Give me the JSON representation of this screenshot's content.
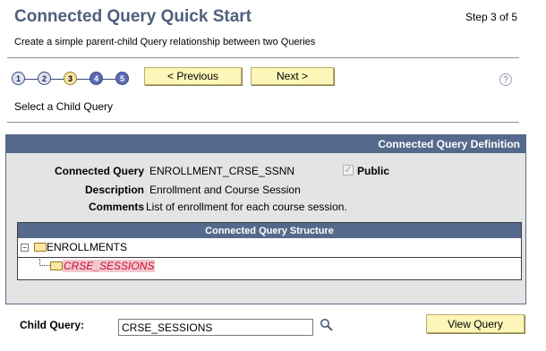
{
  "header": {
    "title": "Connected Query Quick Start",
    "step": "Step 3 of 5",
    "subtitle": "Create a simple parent-child Query relationship between two Queries"
  },
  "wizard": {
    "steps": [
      "1",
      "2",
      "3",
      "4",
      "5"
    ],
    "current_step": 3,
    "previous_label": "< Previous",
    "next_label": "Next >",
    "help_label": "?"
  },
  "section_label": "Select a Child Query",
  "definition": {
    "header": "Connected Query Definition",
    "connected_query_label": "Connected Query",
    "connected_query_value": "ENROLLMENT_CRSE_SSNN",
    "public_label": "Public",
    "public_checked": true,
    "description_label": "Description",
    "description_value": "Enrollment and Course Session",
    "comments_label": "Comments",
    "comments_value": "List of enrollment for each course session.",
    "structure_header": "Connected Query Structure",
    "tree": {
      "root": "ENROLLMENTS",
      "child": "CRSE_SESSIONS"
    }
  },
  "footer": {
    "child_query_label": "Child Query:",
    "child_query_value": "CRSE_SESSIONS",
    "view_query_label": "View Query"
  }
}
